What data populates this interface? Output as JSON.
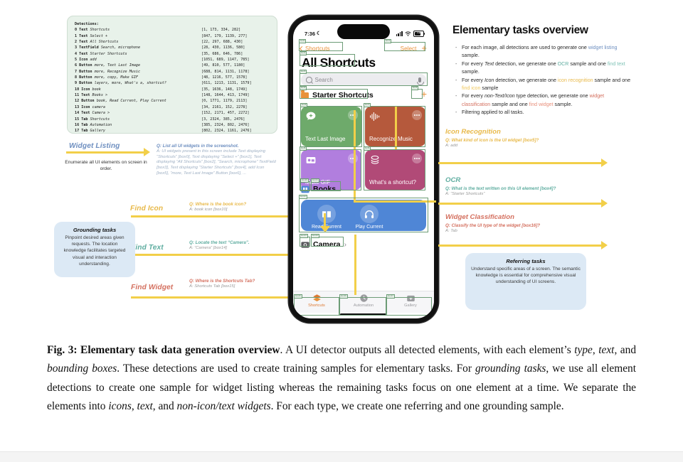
{
  "detections": {
    "title": "Detections:",
    "rows": [
      {
        "idx": "0",
        "type": "Text",
        "desc": "Shortcuts",
        "box": "[1, 173, 334, 282]"
      },
      {
        "idx": "1",
        "type": "Text",
        "desc": "Select +",
        "box": "[847, 179, 1139, 277]"
      },
      {
        "idx": "2",
        "type": "Text",
        "desc": "All Shortcuts",
        "box": "[22, 297, 688, 430]"
      },
      {
        "idx": "3",
        "type": "TextField",
        "desc": "Search, microphone",
        "box": "[28, 430, 1136, 580]"
      },
      {
        "idx": "4",
        "type": "Text",
        "desc": "Starter Shortcuts",
        "box": "[35, 686, 646, 786]"
      },
      {
        "idx": "5",
        "type": "Icon",
        "desc": "add",
        "box": "[1051, 689, 1147, 785]"
      },
      {
        "idx": "6",
        "type": "Button",
        "desc": "more, Text Last Image",
        "box": "[49, 810, 577, 1180]"
      },
      {
        "idx": "7",
        "type": "Button",
        "desc": "more, Recognize Music",
        "box": "[688, 814, 1131, 1178]"
      },
      {
        "idx": "8",
        "type": "Button",
        "desc": "more, copy, Make GIF",
        "box": "[48, 1216, 577, 1578]"
      },
      {
        "idx": "9",
        "type": "Button",
        "desc": "layers, more, What's a, shortcut?",
        "box": "[611, 1213, 1131, 1579]"
      },
      {
        "idx": "10",
        "type": "Icon",
        "desc": "book",
        "box": "[35, 1636, 148, 1749]"
      },
      {
        "idx": "11",
        "type": "Text",
        "desc": "Books >",
        "box": "[148, 1644, 413, 1749]"
      },
      {
        "idx": "12",
        "type": "Button",
        "desc": "book, Read Current, Play Current",
        "box": "[0, 1771, 1179, 2113]"
      },
      {
        "idx": "13",
        "type": "Icon",
        "desc": "camera",
        "box": "[34, 2161, 152, 2278]"
      },
      {
        "idx": "14",
        "type": "Text",
        "desc": "Camera >",
        "box": "[152, 2171, 457, 2272]"
      },
      {
        "idx": "15",
        "type": "Tab",
        "desc": "Shortcuts",
        "box": "[3, 2324, 385, 2476]"
      },
      {
        "idx": "16",
        "type": "Tab",
        "desc": "Automation",
        "box": "[385, 2324, 802, 2476]"
      },
      {
        "idx": "17",
        "type": "Tab",
        "desc": "Gallery",
        "box": "[802, 2324, 1161, 2476]"
      }
    ]
  },
  "left_tasks": {
    "widget_listing": {
      "title": "Widget Listing",
      "subtitle": "Enumerate all UI elements on screen in order.",
      "q": "Q: List all UI widgets in the screenshot.",
      "a": "A: UI widgets present in this screen include Text displaying “Shortcuts” [box0], Text displaying “Select +” [box1], Text displaying “All Shortcuts” [box2], “Search, microphone” TextField [box3], Text displaying “Starter Shortcuts” [box4], add Icon [box5], “more, Text Last Image” Button [box6], ...",
      "color": "#6e8fc0"
    },
    "find_icon": {
      "title": "Find Icon",
      "q": "Q: Where is the book icon?",
      "a": "A: book icon [box10]",
      "color": "#e8b94a"
    },
    "find_text": {
      "title": "Find Text",
      "q": "Q: Locate the text “Camera”.",
      "a": "A: “Camera” [box14]",
      "color": "#5fada0"
    },
    "find_widget": {
      "title": "Find Widget",
      "q": "Q: Where is the Shortcuts Tab?",
      "a": "A: Shortcuts Tab [box15]",
      "color": "#d4705f"
    },
    "grounding_box": {
      "title": "Grounding tasks",
      "body": "Pinpoint desired areas given requests. The location knowledge facilitates targeted visual and interaction understanding."
    }
  },
  "right_panel": {
    "title": "Elementary tasks overview",
    "bullets": [
      {
        "parts": [
          {
            "t": "For each image, all detections are used to generate one ",
            "c": "plain"
          },
          {
            "t": "widget listing",
            "c": "widgetlist"
          },
          {
            "t": " sample.",
            "c": "plain"
          }
        ]
      },
      {
        "parts": [
          {
            "t": "For every ",
            "c": "plain"
          },
          {
            "t": "Text",
            "c": "italic"
          },
          {
            "t": " detection, we generate one ",
            "c": "plain"
          },
          {
            "t": "OCR",
            "c": "ocr"
          },
          {
            "t": " sample and one ",
            "c": "plain"
          },
          {
            "t": "find text",
            "c": "findtext"
          },
          {
            "t": " sample.",
            "c": "plain"
          }
        ]
      },
      {
        "parts": [
          {
            "t": "For every ",
            "c": "plain"
          },
          {
            "t": "Icon",
            "c": "italic"
          },
          {
            "t": " detection, we generate one ",
            "c": "plain"
          },
          {
            "t": "icon recognition",
            "c": "iconrec"
          },
          {
            "t": " sample and one ",
            "c": "plain"
          },
          {
            "t": "find icon",
            "c": "findicon"
          },
          {
            "t": " sample",
            "c": "plain"
          }
        ]
      },
      {
        "parts": [
          {
            "t": "For every ",
            "c": "plain"
          },
          {
            "t": "non-Text/Icon",
            "c": "italic"
          },
          {
            "t": " type detection, we generate one ",
            "c": "plain"
          },
          {
            "t": "widget classification",
            "c": "widgetcls"
          },
          {
            "t": " sample and one ",
            "c": "plain"
          },
          {
            "t": "find widget",
            "c": "findwidget"
          },
          {
            "t": " sample.",
            "c": "plain"
          }
        ]
      },
      {
        "parts": [
          {
            "t": "Filtering applied to all tasks.",
            "c": "plain"
          }
        ]
      }
    ],
    "icon_recognition": {
      "title": "Icon Recognition",
      "q": "Q: What kind of icon is the UI widget [box5]?",
      "a": "A: add",
      "color": "#e8b94a"
    },
    "ocr": {
      "title": "OCR",
      "q": "Q: What is the text written on this UI element [box4]?",
      "a": "A: “Starter Shortcuts”",
      "color": "#5fada0"
    },
    "widget_classification": {
      "title": "Widget Classification",
      "q": "Q: Classify the UI type of the widget [box16]?",
      "a": "A: Tab",
      "color": "#d4705f"
    },
    "referring_box": {
      "title": "Referring tasks",
      "body": "Understand specific areas of a screen. The semantic knowledge is essential for comprehensive visual understanding of UI screens."
    }
  },
  "phone": {
    "status": {
      "time": "7:36",
      "moon": "☾",
      "battery_pct": "72"
    },
    "nav": {
      "back": "Shortcuts",
      "select": "Select",
      "plus": "+"
    },
    "page_title": "All Shortcuts",
    "search_placeholder": "Search",
    "section": {
      "label": "Starter Shortcuts",
      "add": "+"
    },
    "tiles": [
      {
        "label": "Text Last Image",
        "color": "#6eaa6b",
        "icon": "message-plus-icon"
      },
      {
        "label": "Recognize Music",
        "color": "#b5593c",
        "icon": "waveform-icon"
      },
      {
        "label": "Make GIF",
        "color": "#b17ede",
        "icon": "photos-icon"
      },
      {
        "label": "What's a shortcut?",
        "color": "#b14a77",
        "icon": "layers-icon"
      }
    ],
    "books": {
      "label": "Books",
      "chevron": "›"
    },
    "blue_card": [
      {
        "label": "Read Current",
        "icon": "book-icon"
      },
      {
        "label": "Play Current",
        "icon": "headphones-icon"
      }
    ],
    "camera": {
      "label": "Camera",
      "chevron": "›"
    },
    "tabs": [
      {
        "label": "Shortcuts",
        "state": "active"
      },
      {
        "label": "Automation",
        "state": "idle"
      },
      {
        "label": "Gallery",
        "state": "idle"
      }
    ],
    "det_labels": [
      "box0",
      "box1",
      "box2",
      "box3",
      "box4",
      "box5",
      "box6",
      "box7",
      "box8",
      "box9",
      "box10",
      "box11",
      "box12",
      "box13",
      "box14",
      "box15",
      "box16",
      "box17"
    ]
  },
  "caption": {
    "prefix": "Fig. 3: Elementary task data generation overview",
    "rest_1": ". A UI detector outputs all detected elements, with each element’s ",
    "i1": "type",
    "rest_2": ", ",
    "i2": "text",
    "rest_3": ", and ",
    "i3": "bounding boxes",
    "rest_4": ". These detections are used to create training samples for elementary tasks. For ",
    "i4": "grounding tasks",
    "rest_5": ", we use all element detections to create one sample for widget listing whereas the remaining tasks focus on one element at a time. We separate the elements into ",
    "i5": "icons",
    "rest_6": ", ",
    "i6": "text",
    "rest_7": ", and ",
    "i7": "non-icon/text widgets",
    "rest_8": ". For each type, we create one referring and one grounding sample."
  }
}
